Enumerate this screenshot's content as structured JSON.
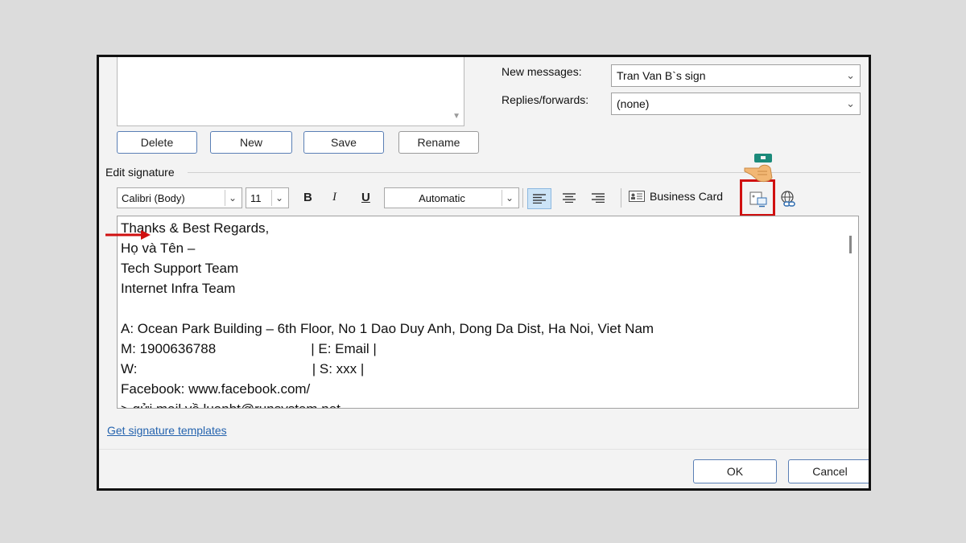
{
  "signatures": {
    "buttons": {
      "delete": "Delete",
      "new": "New",
      "save": "Save",
      "rename": "Rename"
    }
  },
  "defaults": {
    "new_messages_label": "New messages:",
    "new_messages_value": "Tran Van B`s sign",
    "replies_label": "Replies/forwards:",
    "replies_value": "(none)"
  },
  "edit": {
    "section_label": "Edit signature",
    "font": "Calibri (Body)",
    "size": "11",
    "bold": "B",
    "italic": "I",
    "underline": "U",
    "color": "Automatic",
    "business_card": "Business Card",
    "body_lines": [
      "Thanks & Best Regards,",
      "Họ và Tên –",
      "Tech Support Team",
      "Internet Infra Team",
      "",
      "A: Ocean Park Building – 6th Floor, No 1 Dao Duy Anh, Dong Da Dist, Ha Noi, Viet Nam",
      "M: 1900636788                         | E: Email |",
      "W:                                              | S: xxx |",
      "Facebook: www.facebook.com/",
      "> gửi mail về luanbt@runsystem.net"
    ]
  },
  "templates_link": "Get signature templates",
  "footer": {
    "ok": "OK",
    "cancel": "Cancel"
  },
  "colors": {
    "highlight_box": "#d01010",
    "arrow": "#d01010",
    "link": "#2463ae",
    "button_border": "#5a7fb5"
  },
  "icons": [
    "scroll-down-arrow-icon",
    "chevron-down-icon",
    "align-left-icon",
    "align-center-icon",
    "align-right-icon",
    "business-card-icon",
    "picture-icon",
    "hyperlink-icon",
    "pointing-hand-icon",
    "red-arrow-icon"
  ]
}
